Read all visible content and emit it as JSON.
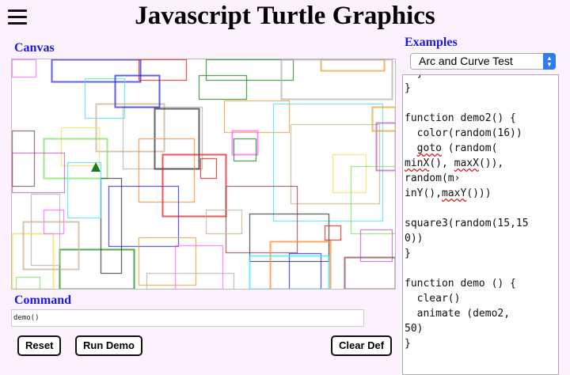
{
  "header": {
    "menu_icon": "hamburger-menu-icon",
    "title": "Javascript Turtle Graphics"
  },
  "canvas": {
    "label": "Canvas",
    "turtle_color": "#1c7a1c"
  },
  "command": {
    "label": "Command",
    "value": "demo()",
    "buttons": {
      "reset": "Reset",
      "run_demo": "Run Demo",
      "clear_def": "Clear Def"
    }
  },
  "examples": {
    "label": "Examples",
    "selected": "Arc and Curve Test",
    "code_lines": [
      "  }",
      "}",
      "",
      "function demo2() {",
      "  color(random(16))",
      "  goto (random(",
      "minX(), maxX()),",
      "random(m›",
      "inY(),maxY()))",
      "",
      "square3(random(15,15",
      "0))",
      "}",
      "",
      "function demo () {",
      "  clear()",
      "  animate (demo2,",
      "50)",
      "}"
    ]
  },
  "colors": {
    "label_blue": "#1a1ae0",
    "page_bg": "#fcf2fd",
    "accent": "#2f7bf0"
  }
}
